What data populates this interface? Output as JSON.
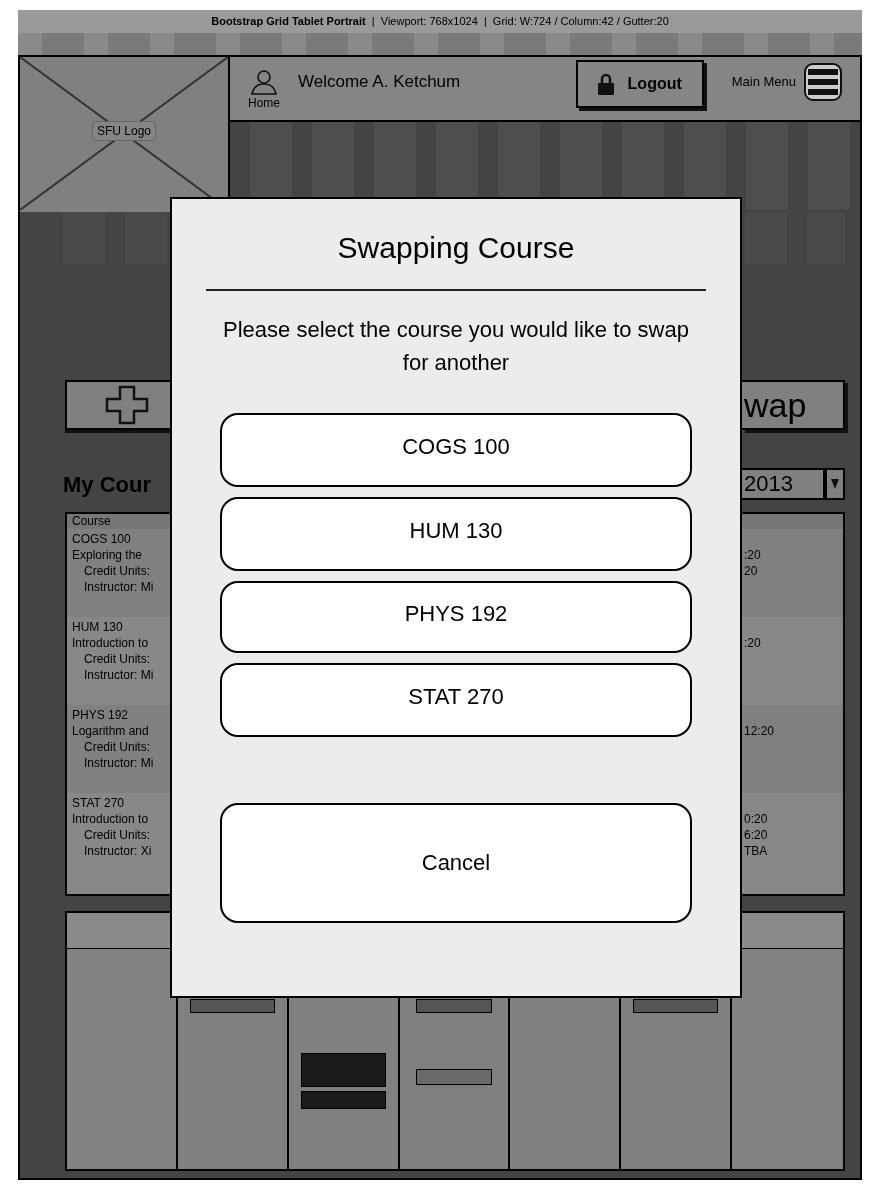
{
  "grid_banner": {
    "text": "**Bootstrap Grid Tablet Portrait**  |  Viewport: 768x1024  |  Grid: W:724 / Column:42 / Gutter:20"
  },
  "header": {
    "logo_label": "SFU Logo",
    "home_label": "Home",
    "welcome": "Welcome A. Ketchum",
    "logout": "Logout",
    "main_menu": "Main Menu"
  },
  "background": {
    "swap_button": "wap",
    "heading": "My Cour",
    "term_select": "2013",
    "table_header": "Course",
    "rows": [
      {
        "code": "COGS 100",
        "title": "Exploring the",
        "credit": "Credit Units:",
        "instructor": "Instructor: Mi",
        "times": [
          ":20",
          "20"
        ]
      },
      {
        "code": "HUM 130",
        "title": "Introduction to",
        "credit": "Credit Units:",
        "instructor": "Instructor: Mi",
        "times": [
          ":20"
        ]
      },
      {
        "code": "PHYS 192",
        "title": "Logarithm and",
        "credit": "Credit Units:",
        "instructor": "Instructor: Mi",
        "times": [
          "12:20"
        ]
      },
      {
        "code": "STAT 270",
        "title": "Introduction to",
        "credit": "Credit Units:",
        "instructor": "Instructor: Xi",
        "times": [
          "0:20",
          "6:20",
          "TBA"
        ]
      }
    ]
  },
  "modal": {
    "title": "Swapping Course",
    "prompt": "Please select the course you would like to swap for another",
    "courses": [
      "COGS 100",
      "HUM 130",
      "PHYS 192",
      "STAT 270"
    ],
    "cancel": "Cancel"
  }
}
